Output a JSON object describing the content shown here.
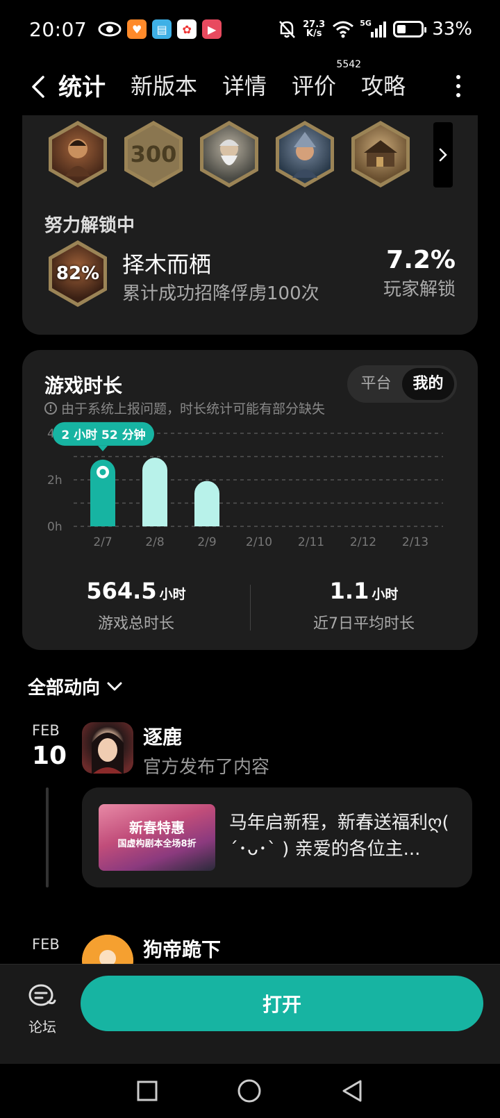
{
  "status_bar": {
    "time": "20:07",
    "net_speed_value": "27.3",
    "net_speed_unit": "K/s",
    "signal_label": "5G",
    "battery": "33%"
  },
  "nav": {
    "tabs": [
      {
        "label": "统计",
        "active": true
      },
      {
        "label": "新版本"
      },
      {
        "label": "详情"
      },
      {
        "label": "评价",
        "badge": "5542"
      },
      {
        "label": "攻略"
      }
    ]
  },
  "achievements": {
    "badge_300": "300",
    "in_progress_title": "努力解锁中",
    "current": {
      "progress": "82%",
      "name": "择木而栖",
      "description": "累计成功招降俘虏100次",
      "unlock_rate": "7.2%",
      "unlock_rate_label": "玩家解锁"
    }
  },
  "playtime": {
    "title": "游戏时长",
    "note": "由于系统上报问题，时长统计可能有部分缺失",
    "segment": {
      "platform": "平台",
      "mine": "我的",
      "selected": "mine"
    },
    "tooltip": "2 小时 52 分钟",
    "total_value": "564.5",
    "total_unit": "小时",
    "total_label": "游戏总时长",
    "avg_value": "1.1",
    "avg_unit": "小时",
    "avg_label": "近7日平均时长"
  },
  "chart_data": {
    "type": "bar",
    "categories": [
      "2/7",
      "2/8",
      "2/9",
      "2/10",
      "2/11",
      "2/12",
      "2/13"
    ],
    "values": [
      2.87,
      2.95,
      1.95,
      0,
      0,
      0,
      0
    ],
    "y_ticks": [
      "0h",
      "2h",
      "4h"
    ],
    "ylim": [
      0,
      4
    ],
    "grid": true,
    "highlight_index": 0,
    "colors": {
      "highlight": "#17b4a2",
      "normal": "#b8f2ea",
      "grid": "#555555"
    }
  },
  "feed": {
    "header": "全部动向",
    "items": [
      {
        "month": "FEB",
        "day": "10",
        "author": "逐鹿",
        "action": "官方发布了内容",
        "thumb_line1": "新春特惠",
        "thumb_line2": "国虚构剧本全场8折",
        "post_text": "马年启新程，新春送福利ღ( ´･ᴗ･` ) 亲爱的各位主..."
      },
      {
        "month": "FEB",
        "author": "狗帝跪下"
      }
    ]
  },
  "bottom": {
    "forum_label": "论坛",
    "open_label": "打开"
  }
}
